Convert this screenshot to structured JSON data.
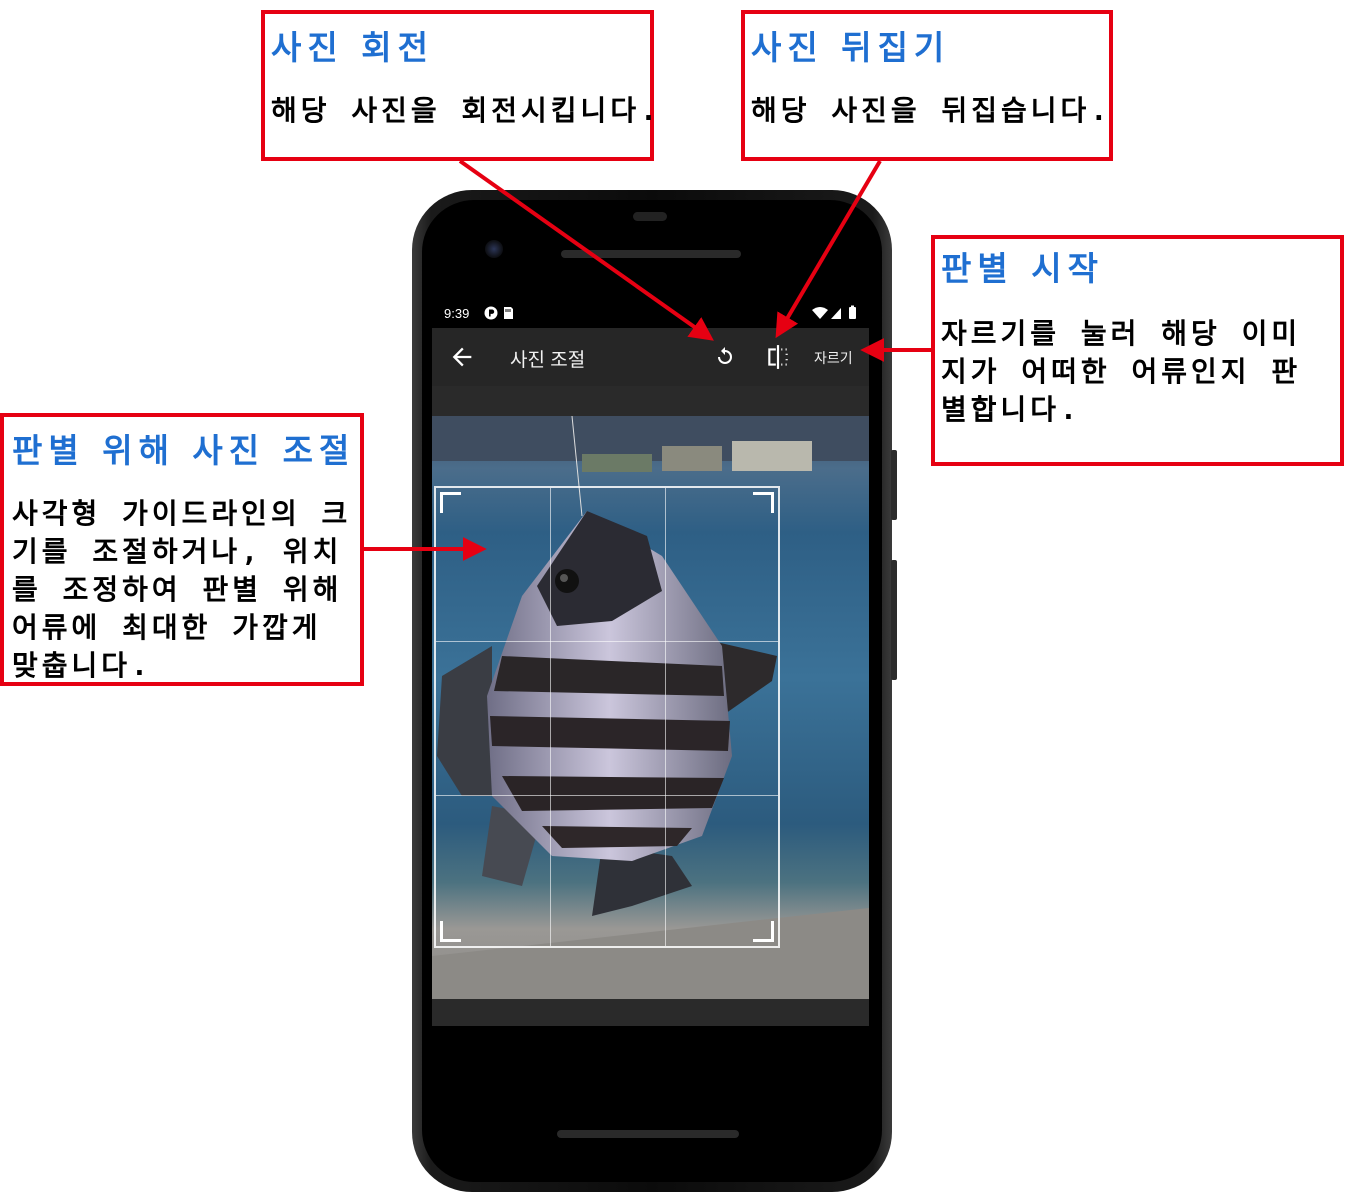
{
  "callouts": {
    "rotate": {
      "title": "사진 회전",
      "desc": "해당 사진을 회전시킵니다."
    },
    "flip": {
      "title": "사진 뒤집기",
      "desc": "해당 사진을 뒤집습니다."
    },
    "crop": {
      "title": "판별 시작",
      "desc": "자르기를 눌러 해당 이미지가 어떠한 어류인지 판별합니다."
    },
    "adjust": {
      "title": "판별 위해 사진 조절",
      "desc": "사각형 가이드라인의 크기를 조절하거나, 위치를 조정하여 판별 위해 어류에 최대한 가깝게 맞춥니다."
    }
  },
  "status_bar": {
    "time": "9:39"
  },
  "toolbar": {
    "title": "사진 조절",
    "crop_label": "자르기",
    "back_icon": "back-arrow-icon",
    "rotate_icon": "rotate-icon",
    "flip_icon": "flip-icon"
  },
  "nav": {
    "back_icon": "nav-back-icon",
    "home_icon": "nav-home-icon",
    "recents_icon": "nav-recents-icon"
  },
  "colors": {
    "callout_border": "#e60012",
    "callout_title": "#1f6fd1",
    "toolbar_bg": "#262626"
  }
}
